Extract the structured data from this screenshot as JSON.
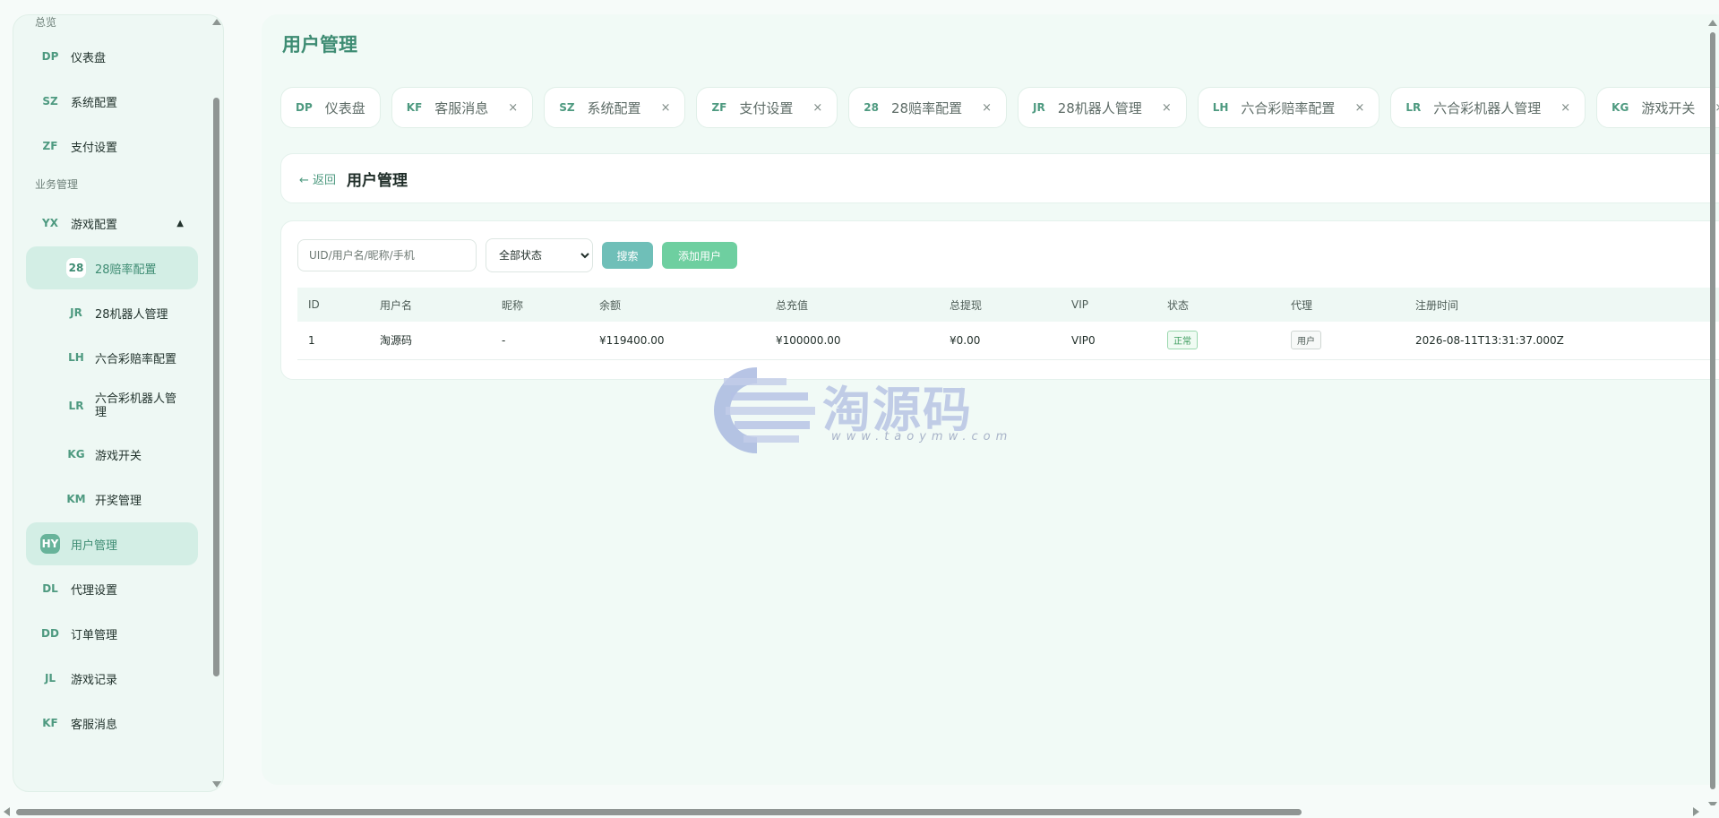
{
  "sidebar": {
    "section_overview": "总览",
    "section_business": "业务管理",
    "items_top": [
      {
        "code": "DP",
        "label": "仪表盘"
      },
      {
        "code": "SZ",
        "label": "系统配置"
      },
      {
        "code": "ZF",
        "label": "支付设置"
      }
    ],
    "game_config": {
      "code": "YX",
      "label": "游戏配置",
      "caret": "▲"
    },
    "game_sub": [
      {
        "code": "28",
        "label": "28赔率配置"
      },
      {
        "code": "JR",
        "label": "28机器人管理"
      },
      {
        "code": "LH",
        "label": "六合彩赔率配置"
      },
      {
        "code": "LR",
        "label": "六合彩机器人管理"
      },
      {
        "code": "KG",
        "label": "游戏开关"
      },
      {
        "code": "KM",
        "label": "开奖管理"
      }
    ],
    "items_bottom": [
      {
        "code": "HY",
        "label": "用户管理"
      },
      {
        "code": "DL",
        "label": "代理设置"
      },
      {
        "code": "DD",
        "label": "订单管理"
      },
      {
        "code": "JL",
        "label": "游戏记录"
      },
      {
        "code": "KF",
        "label": "客服消息"
      }
    ]
  },
  "page": {
    "title": "用户管理"
  },
  "tabs": [
    {
      "code": "DP",
      "label": "仪表盘",
      "close": ""
    },
    {
      "code": "KF",
      "label": "客服消息",
      "close": "×"
    },
    {
      "code": "SZ",
      "label": "系统配置",
      "close": "×"
    },
    {
      "code": "ZF",
      "label": "支付设置",
      "close": "×"
    },
    {
      "code": "28",
      "label": "28赔率配置",
      "close": "×"
    },
    {
      "code": "JR",
      "label": "28机器人管理",
      "close": "×"
    },
    {
      "code": "LH",
      "label": "六合彩赔率配置",
      "close": "×"
    },
    {
      "code": "LR",
      "label": "六合彩机器人管理",
      "close": "×"
    },
    {
      "code": "KG",
      "label": "游戏开关",
      "close": "×"
    }
  ],
  "header": {
    "back_label": "← 返回",
    "title": "用户管理"
  },
  "toolbar": {
    "search_placeholder": "UID/用户名/昵称/手机",
    "status_selected": "全部状态",
    "search_button": "搜索",
    "add_button": "添加用户"
  },
  "table": {
    "columns": [
      "ID",
      "用户名",
      "昵称",
      "余额",
      "总充值",
      "总提现",
      "VIP",
      "状态",
      "代理",
      "注册时间"
    ],
    "rows": [
      {
        "id": "1",
        "username": "淘源码",
        "nickname": "-",
        "balance": "¥119400.00",
        "total_recharge": "¥100000.00",
        "total_withdraw": "¥0.00",
        "vip": "VIP0",
        "status": "正常",
        "agent": "用户",
        "registered": "2026-08-11T13:31:37.000Z"
      }
    ]
  },
  "watermark": {
    "text": "淘源码",
    "url": "www.taoymw.com"
  },
  "colors": {
    "accent": "#3e8c73",
    "search_button": "#6fbfb8",
    "add_button": "#6ecfa0"
  }
}
